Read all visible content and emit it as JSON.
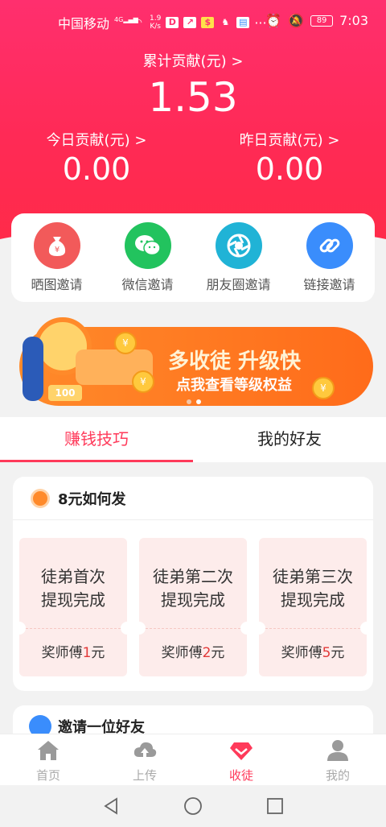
{
  "status_bar": {
    "carrier": "中国移动",
    "network": "4G",
    "speed": "1.9\nK/s",
    "battery": "89",
    "time": "7:03"
  },
  "header": {
    "total_label": "累计贡献(元) >",
    "total_value": "1.53",
    "today_label": "今日贡献(元) >",
    "today_value": "0.00",
    "yesterday_label": "昨日贡献(元) >",
    "yesterday_value": "0.00"
  },
  "invite": {
    "items": [
      {
        "label": "晒图邀请",
        "icon": "money-bag-icon",
        "color": "#f25a5a",
        "glyph": "¥"
      },
      {
        "label": "微信邀请",
        "icon": "wechat-icon",
        "color": "#22c35e",
        "glyph": "◉"
      },
      {
        "label": "朋友圈邀请",
        "icon": "moments-icon",
        "color": "#20b3d6",
        "glyph": "✷"
      },
      {
        "label": "链接邀请",
        "icon": "link-icon",
        "color": "#3a8dfc",
        "glyph": "⚭"
      }
    ]
  },
  "banner": {
    "title": "多收徒 升级快",
    "subtitle": "点我查看等级权益",
    "coin": "¥",
    "tag": "100",
    "accent": "#ff7a22"
  },
  "tabs": [
    {
      "label": "赚钱技巧",
      "active": true
    },
    {
      "label": "我的好友",
      "active": false
    }
  ],
  "rewards": {
    "title": "8元如何发",
    "tickets": [
      {
        "line1": "徒弟首次",
        "line2": "提现完成",
        "prefix": "奖师傅",
        "amount": "1",
        "unit": "元"
      },
      {
        "line1": "徒弟第二次",
        "line2": "提现完成",
        "prefix": "奖师傅",
        "amount": "2",
        "unit": "元"
      },
      {
        "line1": "徒弟第三次",
        "line2": "提现完成",
        "prefix": "奖师傅",
        "amount": "5",
        "unit": "元"
      }
    ]
  },
  "friend_section": {
    "title": "邀请一位好友"
  },
  "bottom_nav": [
    {
      "label": "首页",
      "icon": "home-icon",
      "active": false
    },
    {
      "label": "上传",
      "icon": "cloud-upload-icon",
      "active": false
    },
    {
      "label": "收徒",
      "icon": "diamond-icon",
      "active": true
    },
    {
      "label": "我的",
      "icon": "user-icon",
      "active": false
    }
  ]
}
